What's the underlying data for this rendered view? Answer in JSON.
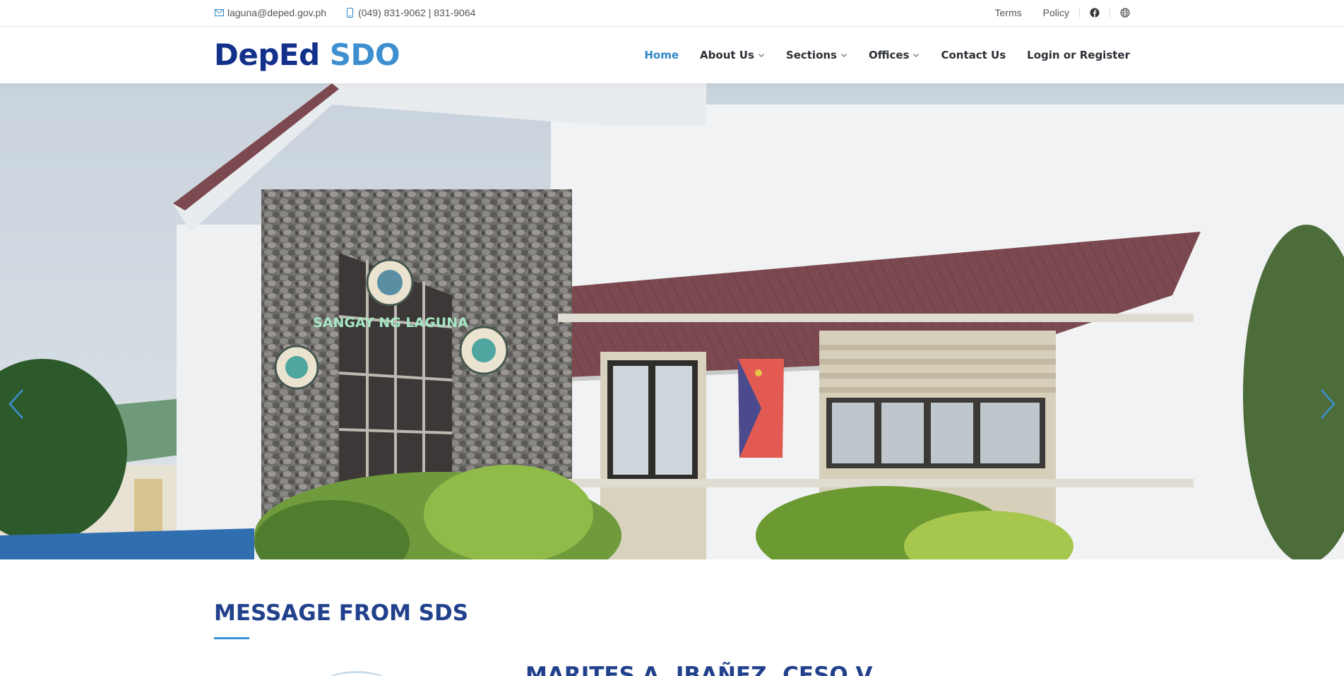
{
  "topbar": {
    "email": "laguna@deped.gov.ph",
    "phone": "(049) 831-9062 | 831-9064",
    "email_icon": "mail-icon",
    "phone_icon": "phone-icon",
    "terms": "Terms",
    "policy": "Policy",
    "facebook_icon": "facebook-icon",
    "web_icon": "globe-icon"
  },
  "header": {
    "logo_part1": "DepEd",
    "logo_part2": "SDO",
    "nav": [
      {
        "label": "Home",
        "active": true,
        "dropdown": false
      },
      {
        "label": "About Us",
        "active": false,
        "dropdown": true
      },
      {
        "label": "Sections",
        "active": false,
        "dropdown": true
      },
      {
        "label": "Offices",
        "active": false,
        "dropdown": true
      },
      {
        "label": "Contact Us",
        "active": false,
        "dropdown": false
      },
      {
        "label": "Login or Register",
        "active": false,
        "dropdown": false
      }
    ]
  },
  "hero": {
    "sign_text": "SANGAY NG LAGUNA",
    "prev_icon": "chevron-left-icon",
    "next_icon": "chevron-right-icon"
  },
  "message": {
    "heading": "MESSAGE FROM SDS",
    "name": "MARITES A. IBAÑEZ, CESO V"
  },
  "colors": {
    "primary": "#13318a",
    "accent": "#3d8fcf",
    "active_nav": "#2f86c6"
  }
}
